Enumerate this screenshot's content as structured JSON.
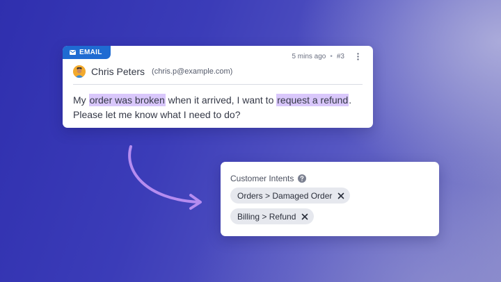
{
  "email_card": {
    "badge": "EMAIL",
    "time": "5 mins ago",
    "separator": "•",
    "ticket": "#3",
    "sender_name": "Chris Peters",
    "sender_email": "(chris.p@example.com)",
    "message": {
      "part1": "My ",
      "highlight1": "order was broken",
      "part2": " when it arrived, I want to ",
      "highlight2": "request a refund",
      "part3": ". Please let me know what I need to do?"
    },
    "highlight_color": "#d9c7fb",
    "badge_color": "#1f6bd2"
  },
  "intents": {
    "title": "Customer Intents",
    "tags": [
      {
        "label": "Orders > Damaged Order"
      },
      {
        "label": "Billing > Refund"
      }
    ]
  },
  "icons": [
    "mail-icon",
    "kebab-icon",
    "avatar",
    "curved-arrow-icon",
    "help-icon",
    "close-icon"
  ],
  "arrow_color": "#b58cf0"
}
